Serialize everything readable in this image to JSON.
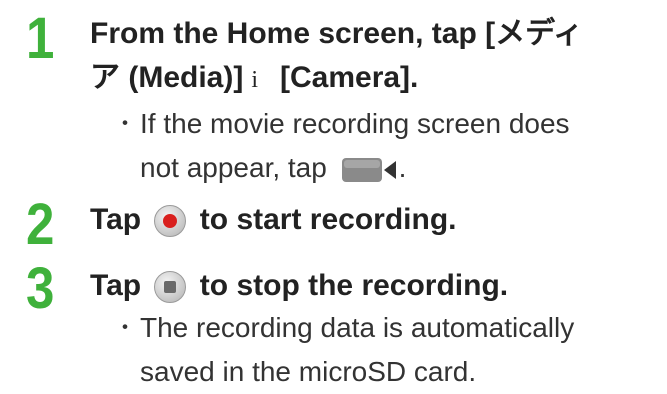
{
  "steps": [
    {
      "number": "1",
      "title_line1": "From the Home screen, tap [メディ",
      "title_line2_a": "ア (Media)]",
      "title_line2_sep": "i",
      "title_line2_b": "[Camera].",
      "note_bullet": "・",
      "note_line1": "If the movie recording screen does",
      "note_line2": "not appear, tap",
      "note_line2_end": ".",
      "note_icon": "video-camera-icon"
    },
    {
      "number": "2",
      "title_a": "Tap",
      "title_b": "to start recording.",
      "icon": "record-button-icon"
    },
    {
      "number": "3",
      "title_a": "Tap",
      "title_b": "to stop the recording.",
      "icon": "stop-button-icon",
      "note_bullet": "・",
      "note_line1": "The recording data is automatically",
      "note_line2": "saved in the microSD card."
    }
  ],
  "colors": {
    "step_number": "#3fb13b",
    "record_red": "#d9201e",
    "icon_gray": "#8a8a8a"
  }
}
